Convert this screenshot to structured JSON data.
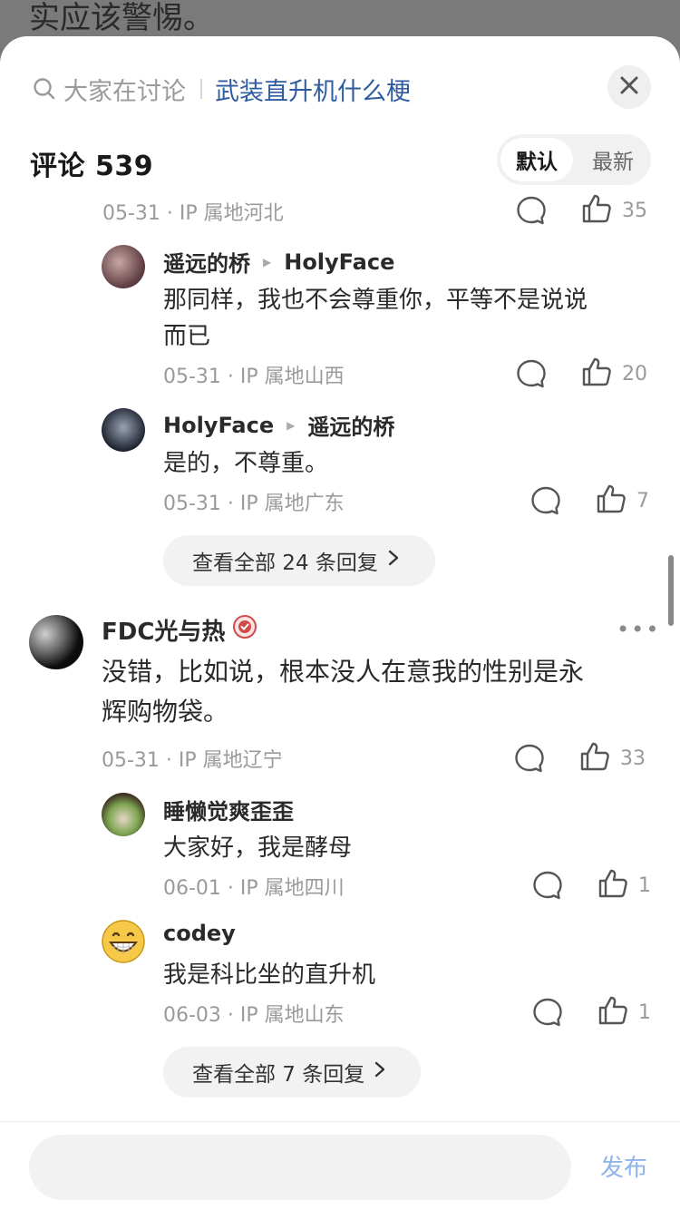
{
  "background_text": "实应该警惕。",
  "header": {
    "search_hint": "大家在讨论",
    "search_topic": "武装直升机什么梗",
    "close_icon": "close-icon"
  },
  "comments_title": "评论 539",
  "sort": {
    "default_label": "默认",
    "newest_label": "最新"
  },
  "thread1": {
    "parent_meta": "05-31 · IP 属地河北",
    "parent_likes": "35",
    "replies": [
      {
        "user": "遥远的桥",
        "reply_to": "HolyFace",
        "text_line1": "那同样，我也不会尊重你，平等不是说说",
        "text_line2": "而已",
        "meta": "05-31 · IP 属地山西",
        "likes": "20"
      },
      {
        "user": "HolyFace",
        "reply_to": "遥远的桥",
        "text_line1": "是的，不尊重。",
        "meta": "05-31 · IP 属地广东",
        "likes": "7"
      }
    ],
    "more_replies": "查看全部 24 条回复"
  },
  "thread2": {
    "user": "FDC光与热",
    "text_line1": "没错，比如说，根本没人在意我的性别是永",
    "text_line2": "辉购物袋。",
    "meta": "05-31 · IP 属地辽宁",
    "likes": "33",
    "more_dots": "•••",
    "replies": [
      {
        "user": "睡懒觉爽歪歪",
        "text": "大家好，我是酵母",
        "meta": "06-01 · IP 属地四川",
        "likes": "1"
      },
      {
        "user": "codey",
        "text": "我是科比坐的直升机",
        "meta": "06-03 · IP 属地山东",
        "likes": "1"
      }
    ],
    "more_replies": "查看全部 7 条回复"
  },
  "bottom": {
    "input_placeholder": "",
    "publish_label": "发布"
  },
  "colors": {
    "accent": "#2f5c9e",
    "publish": "#8fb4e8",
    "meta": "#9a9a9a"
  }
}
